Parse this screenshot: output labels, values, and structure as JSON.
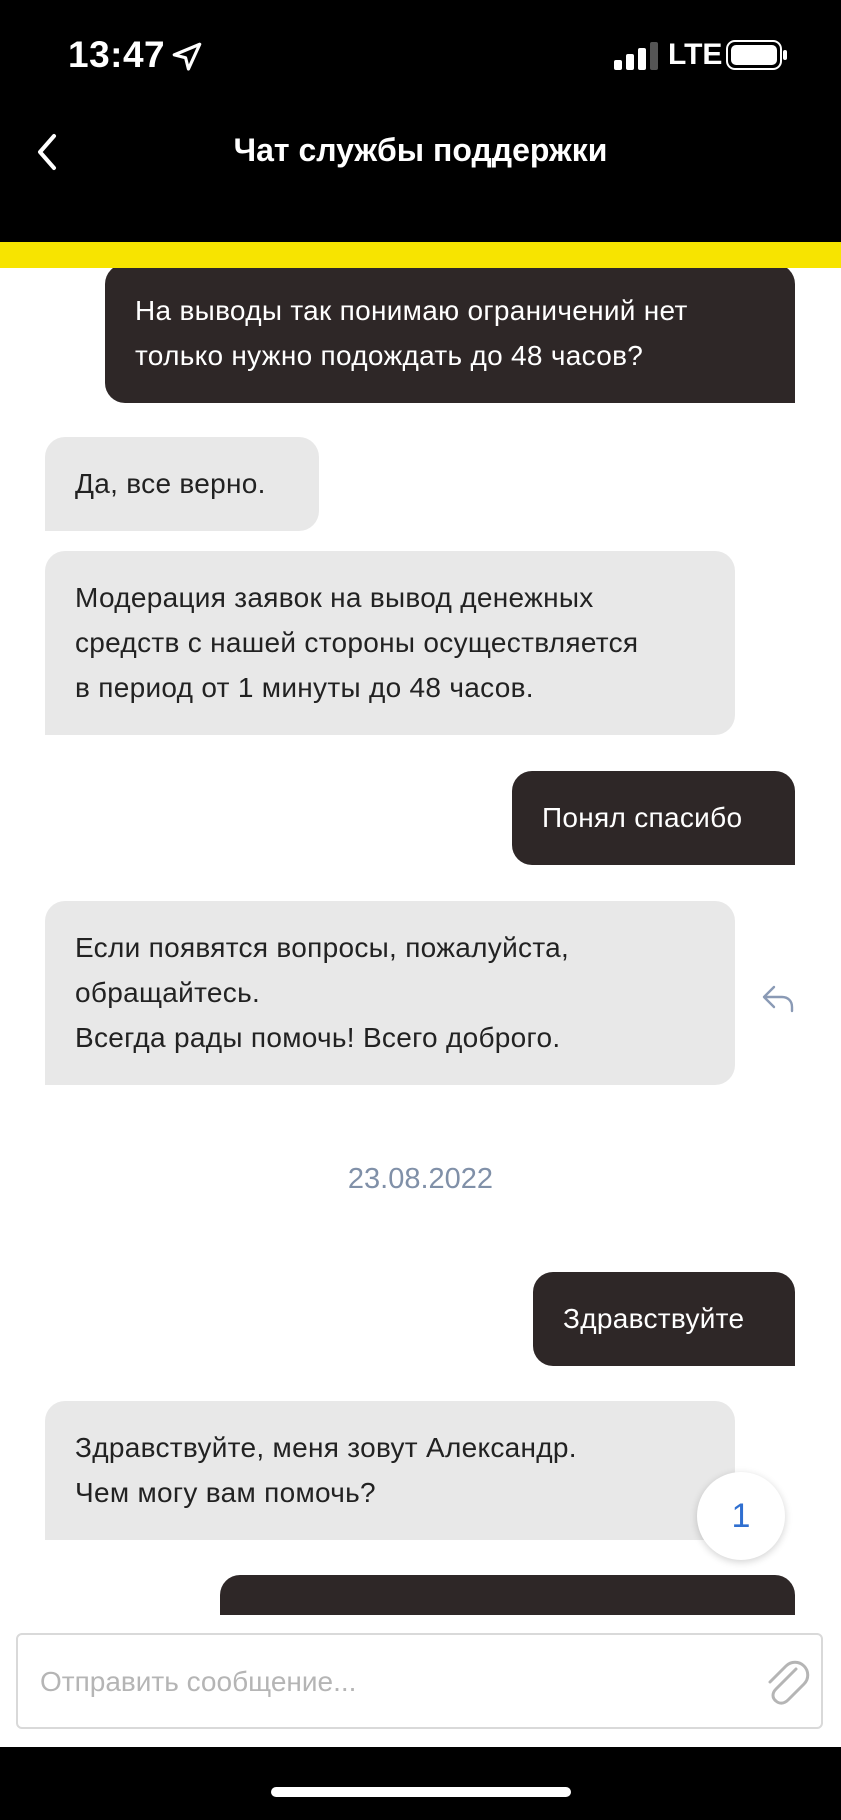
{
  "status_bar": {
    "time": "13:47",
    "network": "LTE",
    "location_icon": "location-arrow-icon",
    "signal_icon": "signal-bars-icon",
    "battery_icon": "battery-icon"
  },
  "header": {
    "title": "Чат службы поддержки",
    "back_icon": "chevron-left-icon"
  },
  "colors": {
    "accent_yellow": "#f7e400",
    "outgoing_bubble": "#2e2727",
    "incoming_bubble": "#e8e8e8",
    "badge_text": "#2f6fd0",
    "date_text": "#8090a8"
  },
  "messages": [
    {
      "direction": "outgoing",
      "text": "На выводы так понимаю ограничений нет\nтолько нужно подождать до 48 часов?"
    },
    {
      "direction": "incoming",
      "text": "Да, все верно."
    },
    {
      "direction": "incoming",
      "text": "Модерация заявок на вывод денежных\nсредств с нашей стороны осуществляется\nв период от 1 минуты до 48 часов."
    },
    {
      "direction": "outgoing",
      "text": "Понял спасибо"
    },
    {
      "direction": "incoming",
      "text": "Если появятся вопросы, пожалуйста,\nобращайтесь.\nВсегда рады помочь! Всего доброго."
    },
    {
      "direction": "outgoing",
      "text": "Здравствуйте"
    },
    {
      "direction": "incoming",
      "text": "Здравствуйте, меня зовут Александр.\nЧем могу вам помочь?"
    },
    {
      "direction": "outgoing",
      "text": ""
    }
  ],
  "date_separator": "23.08.2022",
  "reply_icon": "reply-icon",
  "unread_badge": {
    "count": "1"
  },
  "composer": {
    "placeholder": "Отправить сообщение...",
    "value": "",
    "attach_icon": "paperclip-icon"
  }
}
